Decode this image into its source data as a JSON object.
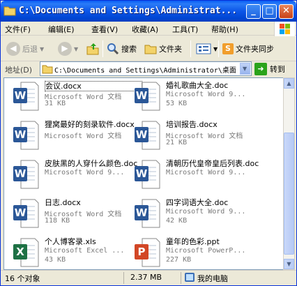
{
  "window": {
    "title": "C:\\Documents and Settings\\Administrat..."
  },
  "menu": [
    "文件(F)",
    "编辑(E)",
    "查看(V)",
    "收藏(A)",
    "工具(T)",
    "帮助(H)"
  ],
  "toolbar": {
    "back_label": "后退",
    "search_label": "搜索",
    "folders_label": "文件夹",
    "sync_label": "文件夹同步"
  },
  "address": {
    "label": "地址(D)",
    "value": "C:\\Documents and Settings\\Administrator\\桌面",
    "go_label": "转到"
  },
  "files": [
    {
      "name": "会议.docx",
      "type": "Microsoft Word 文档",
      "size": "31 KB",
      "icon": "word-icon",
      "color": "#2b5797"
    },
    {
      "name": "婚礼歌曲大全.doc",
      "type": "Microsoft Word 9...",
      "size": "53 KB",
      "icon": "word-icon",
      "color": "#2b5797"
    },
    {
      "name": "狸窝最好的刻录软件.docx",
      "type": "Microsoft Word 文档",
      "size": "",
      "icon": "word-icon",
      "color": "#2b5797"
    },
    {
      "name": "培训报告.docx",
      "type": "Microsoft Word 文档",
      "size": "21 KB",
      "icon": "word-icon",
      "color": "#2b5797"
    },
    {
      "name": "皮肤黑的人穿什么颜色.doc",
      "type": "Microsoft Word 9...",
      "size": "",
      "icon": "word-icon",
      "color": "#2b5797"
    },
    {
      "name": "清朝历代皇帝皇后列表.doc",
      "type": "Microsoft Word 9...",
      "size": "",
      "icon": "word-icon",
      "color": "#2b5797"
    },
    {
      "name": "日志.docx",
      "type": "Microsoft Word 文档",
      "size": "118 KB",
      "icon": "word-icon",
      "color": "#2b5797"
    },
    {
      "name": "四字词语大全.doc",
      "type": "Microsoft Word 9...",
      "size": "42 KB",
      "icon": "word-icon",
      "color": "#2b5797"
    },
    {
      "name": "个人博客录.xls",
      "type": "Microsoft Excel ...",
      "size": "43 KB",
      "icon": "excel-icon",
      "color": "#1e7145"
    },
    {
      "name": "童年的色彩.ppt",
      "type": "Microsoft PowerP...",
      "size": "227 KB",
      "icon": "powerpoint-icon",
      "color": "#d24726"
    }
  ],
  "status": {
    "count": "16 个对象",
    "size": "2.37 MB",
    "location": "我的电脑"
  }
}
